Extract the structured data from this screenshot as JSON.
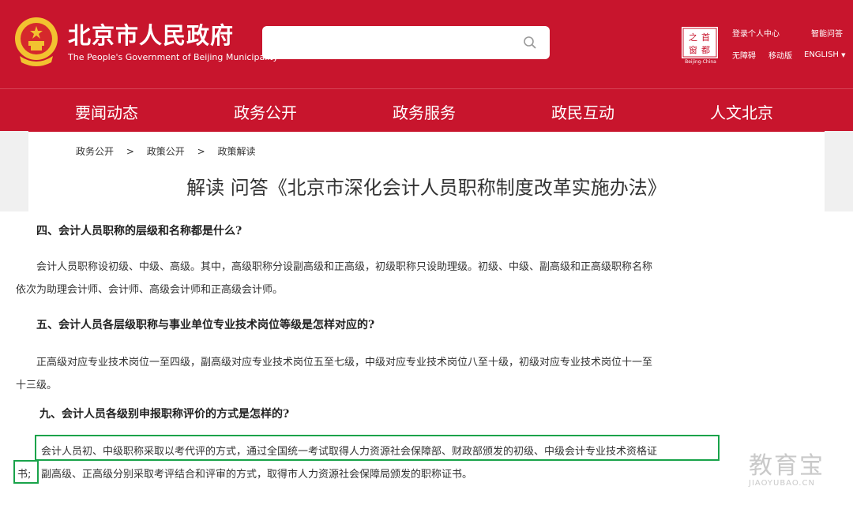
{
  "header": {
    "title_cn": "北京市人民政府",
    "title_en": "The People's Government of Beijing Municipality",
    "search": {
      "placeholder": ""
    },
    "beijing_logo_caption": "Beijing-China",
    "links": {
      "login": "登录个人中心",
      "smart_qa": "智能问答",
      "accessibility": "无障碍",
      "mobile": "移动版",
      "english": "ENGLISH"
    }
  },
  "nav": [
    "要闻动态",
    "政务公开",
    "政务服务",
    "政民互动",
    "人文北京"
  ],
  "breadcrumb": [
    "政务公开",
    "政策公开",
    "政策解读"
  ],
  "breadcrumb_sep": ">",
  "page_title": "解读 问答《北京市深化会计人员职称制度改革实施办法》",
  "content": {
    "q4": "四、会计人员职称的层级和名称都是什么?",
    "a4_line1": "会计人员职称设初级、中级、高级。其中，高级职称分设副高级和正高级，初级职称只设助理级。初级、中级、副高级和正高级职称名称",
    "a4_line2": "依次为助理会计师、会计师、高级会计师和正高级会计师。",
    "q5": "五、会计人员各层级职称与事业单位专业技术岗位等级是怎样对应的?",
    "a5_line1": "正高级对应专业技术岗位一至四级，副高级对应专业技术岗位五至七级，中级对应专业技术岗位八至十级，初级对应专业技术岗位十一至",
    "a5_line2": "十三级。",
    "q9": "九、会计人员各级别申报职称评价的方式是怎样的?",
    "a9_line1": "会计人员初、中级职称采取以考代评的方式，通过全国统一考试取得人力资源社会保障部、财政部颁发的初级、中级会计专业技术资格证",
    "a9_line2_start": "书;",
    "a9_line2_rest": "副高级、正高级分别采取考评结合和评审的方式，取得市人力资源社会保障局颁发的职称证书。"
  },
  "watermark": {
    "text": "教育宝",
    "url": "JIAOYUBAO.CN"
  },
  "colors": {
    "brand_red": "#c8152d",
    "highlight_green": "#19a34a"
  }
}
